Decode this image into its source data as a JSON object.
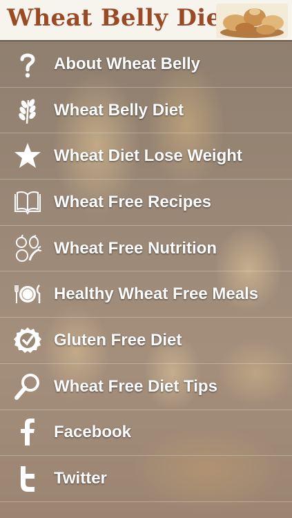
{
  "header": {
    "title": "Wheat Belly Diet"
  },
  "menu": {
    "items": [
      {
        "label": "About Wheat Belly",
        "icon": "question-icon"
      },
      {
        "label": "Wheat Belly Diet",
        "icon": "wheat-icon"
      },
      {
        "label": "Wheat Diet Lose Weight",
        "icon": "star-icon"
      },
      {
        "label": "Wheat Free Recipes",
        "icon": "book-icon"
      },
      {
        "label": "Wheat Free Nutrition",
        "icon": "fruits-icon"
      },
      {
        "label": "Healthy Wheat Free Meals",
        "icon": "plate-cutlery-icon"
      },
      {
        "label": "Gluten Free Diet",
        "icon": "checkmark-badge-icon"
      },
      {
        "label": "Wheat Free Diet Tips",
        "icon": "magnifier-icon"
      },
      {
        "label": "Facebook",
        "icon": "facebook-icon"
      },
      {
        "label": "Twitter",
        "icon": "twitter-icon"
      }
    ]
  },
  "colors": {
    "header_title": "#9a4a25",
    "header_bg": "#f7f4ee",
    "menu_text": "#ffffff"
  }
}
